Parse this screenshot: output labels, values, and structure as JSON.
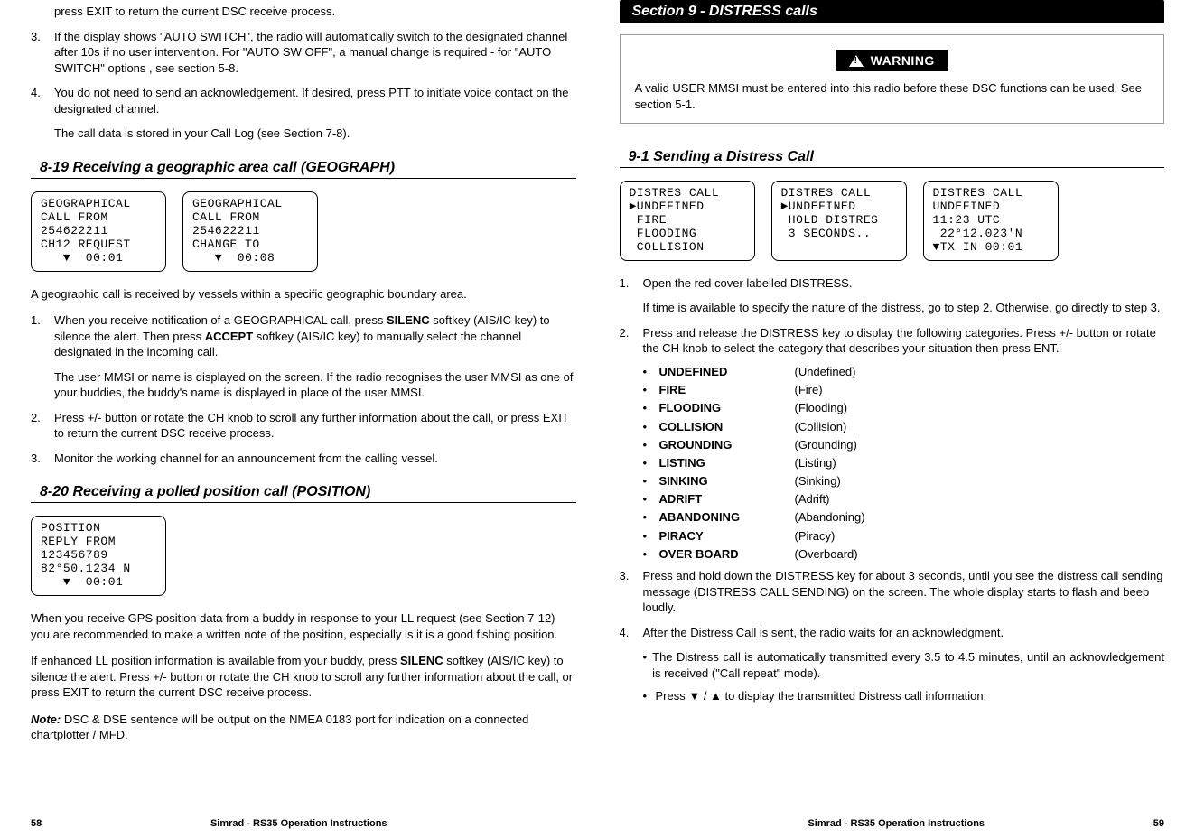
{
  "left": {
    "intro_cont": "press EXIT to return the current DSC receive process.",
    "item3_num": "3.",
    "item3": "If the display shows \"AUTO SWITCH\", the radio will automatically switch to the designated channel after 10s if no user intervention. For \"AUTO SW OFF\", a manual change is required - for \"AUTO SWITCH\" options , see section 5-8.",
    "item4_num": "4.",
    "item4": "You do not need to send an acknowledgement. If desired, press PTT to initiate voice contact on the designated channel.",
    "item4_sub": "The call data is stored in your Call Log (see Section 7-8).",
    "h819": "8-19 Receiving a geographic area call (GEOGRAPH)",
    "lcd819a": "GEOGRAPHICAL\nCALL FROM\n254622211\nCH12 REQUEST\n   ▼  00:01",
    "lcd819b": "GEOGRAPHICAL\nCALL FROM\n254622211\nCHANGE TO\n   ▼  00:08",
    "p819a": "A geographic call is received by vessels within a specific geographic boundary area.",
    "p819_1n": "1.",
    "p819_1a": "When you receive notification of a GEOGRAPHICAL call, press ",
    "p819_1b": "SILENC",
    "p819_1c": " softkey (AIS/IC key) to silence the alert. Then press ",
    "p819_1d": "ACCEPT",
    "p819_1e": " softkey (AIS/IC key) to manually select the channel designated in the incoming call.",
    "p819_1sub": "The user MMSI or name is displayed on the screen. If the radio recognises the user MMSI as one of your buddies, the buddy's name is displayed in place of the user MMSI.",
    "p819_2n": "2.",
    "p819_2": "Press +/- button or rotate the CH knob to scroll any further information about the call, or press EXIT to return the current DSC receive process.",
    "p819_3n": "3.",
    "p819_3": "Monitor the working channel for an announcement from the calling vessel.",
    "h820": "8-20 Receiving a polled position call (POSITION)",
    "lcd820": "POSITION\nREPLY FROM\n123456789\n82°50.1234 N\n   ▼  00:01",
    "p820a": "When you receive GPS position data from a buddy in response to your LL request (see Section 7-12) you are recommended to make a written note of the position, especially is it is a good fishing position.",
    "p820b_a": "If enhanced LL position information is available from your buddy, press ",
    "p820b_b": "SILENC",
    "p820b_c": " softkey (AIS/IC key) to silence the alert. Press +/- button or rotate the CH knob to scroll any further information about the call, or press EXIT to return the current DSC receive process.",
    "note_label": "Note:",
    "note_body": " DSC & DSE sentence will be output on the NMEA 0183 port for indication on a connected chartplotter / MFD.",
    "footer_pg": "58",
    "footer_title": "Simrad - RS35 Operation Instructions"
  },
  "right": {
    "banner": "Section 9 - DISTRESS calls",
    "warning_label": "WARNING",
    "warning_body": "A valid USER MMSI must be entered into this radio before these DSC functions can be used. See section 5-1.",
    "h91": "9-1 Sending a Distress Call",
    "lcd91a": "DISTRES CALL\n►UNDEFINED\n FIRE\n FLOODING\n COLLISION",
    "lcd91b": "DISTRES CALL\n►UNDEFINED\n HOLD DISTRES\n 3 SECONDS..",
    "lcd91c": "DISTRES CALL\nUNDEFINED\n11:23 UTC\n 22°12.023'N\n▼TX IN 00:01",
    "s1n": "1.",
    "s1": "Open the red cover labelled DISTRESS.",
    "s1sub": "If time is available to specify the nature of the distress, go to step 2. Otherwise, go directly to step 3.",
    "s2n": "2.",
    "s2": "Press and release the DISTRESS key to display the following categories. Press +/- button or rotate the CH knob to select the category that describes your situation then press ENT.",
    "cats": [
      {
        "term": "UNDEFINED",
        "def": "(Undefined)"
      },
      {
        "term": "FIRE",
        "def": "(Fire)"
      },
      {
        "term": "FLOODING",
        "def": "(Flooding)"
      },
      {
        "term": "COLLISION",
        "def": "(Collision)"
      },
      {
        "term": "GROUNDING",
        "def": "(Grounding)"
      },
      {
        "term": "LISTING",
        "def": "(Listing)"
      },
      {
        "term": "SINKING",
        "def": "(Sinking)"
      },
      {
        "term": "ADRIFT",
        "def": "(Adrift)"
      },
      {
        "term": "ABANDONING",
        "def": "(Abandoning)"
      },
      {
        "term": "PIRACY",
        "def": "(Piracy)"
      },
      {
        "term": "OVER BOARD",
        "def": "(Overboard)"
      }
    ],
    "s3n": "3.",
    "s3": "Press and hold down the DISTRESS key for about 3 seconds, until you see the distress call sending message (DISTRESS CALL SENDING) on the screen. The whole display starts to flash and beep loudly.",
    "s4n": "4.",
    "s4": "After the Distress Call is sent, the radio waits for an acknowledgment.",
    "s4b1": "The Distress call is automatically transmitted every 3.5 to 4.5 minutes, until an acknowledgement is received (\"Call repeat\" mode).",
    "s4b2": "Press ▼ / ▲ to display the transmitted Distress call information.",
    "footer_title": "Simrad - RS35 Operation Instructions",
    "footer_pg": "59"
  }
}
